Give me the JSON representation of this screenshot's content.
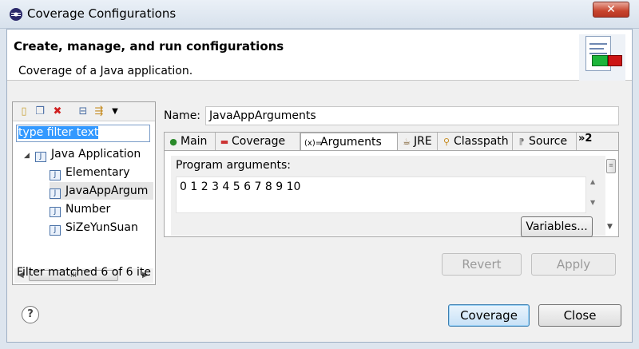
{
  "window": {
    "title": "Coverage Configurations",
    "close_glyph": "✕"
  },
  "header": {
    "title": "Create, manage, and run configurations",
    "description": "Coverage of a Java application."
  },
  "left_panel": {
    "toolbar_icons": [
      "new-config-icon",
      "duplicate-icon",
      "delete-icon",
      "collapse-all-icon",
      "filter-icon",
      "view-menu-icon"
    ],
    "filter_text": "type filter text",
    "tree": {
      "group": "Java Application",
      "items": [
        "Elementary",
        "JavaAppArgum",
        "Number",
        "SiZeYunSuan"
      ]
    },
    "scroll_label": "III",
    "status": "Filter matched 6 of 6 ite"
  },
  "main": {
    "name_label": "Name:",
    "name_value": "JavaAppArguments",
    "tabs": [
      {
        "label": "Main",
        "icon": "main-tab-icon"
      },
      {
        "label": "Coverage",
        "icon": "coverage-tab-icon"
      },
      {
        "label": "Arguments",
        "icon": "arguments-tab-icon"
      },
      {
        "label": "JRE",
        "icon": "jre-tab-icon"
      },
      {
        "label": "Classpath",
        "icon": "classpath-tab-icon"
      },
      {
        "label": "Source",
        "icon": "source-tab-icon"
      }
    ],
    "tab_overflow": "»2",
    "program_arguments_label": "Program arguments:",
    "program_arguments_value": "0 1 2 3 4 5 6 7 8 9 10",
    "variables_label": "Variables..."
  },
  "actions": {
    "revert_label": "Revert",
    "apply_label": "Apply",
    "coverage_label": "Coverage",
    "close_label": "Close",
    "help_glyph": "?"
  },
  "colors": {
    "accent": "#3399ff",
    "title_close": "#c7442d"
  }
}
